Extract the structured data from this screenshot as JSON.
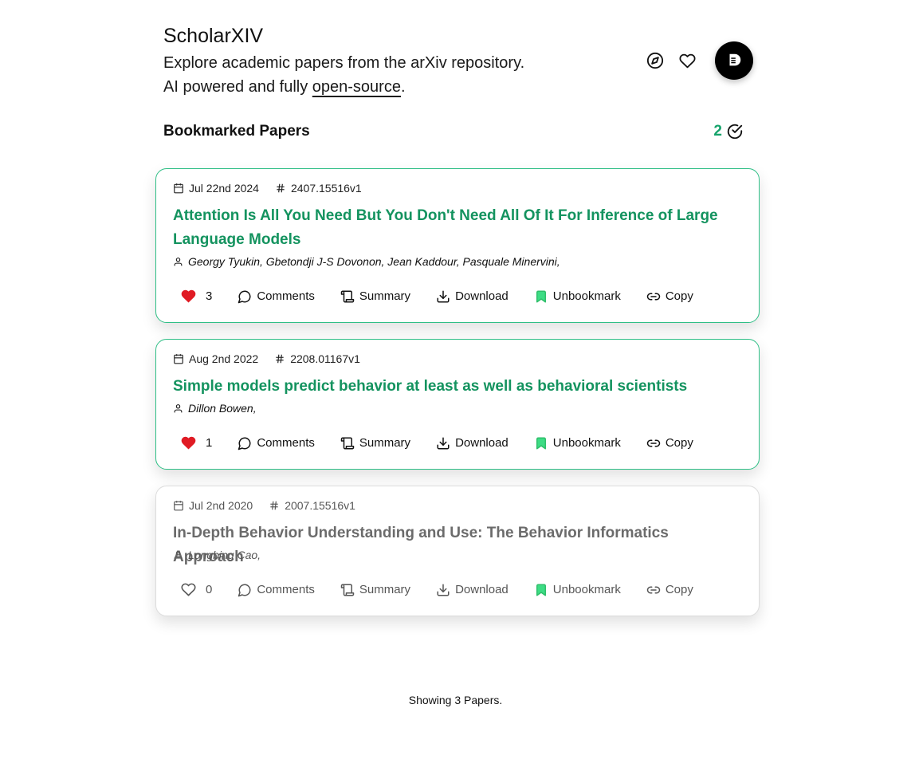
{
  "app": {
    "title": "ScholarXIV",
    "tagline_line1": "Explore academic papers from the arXiv repository.",
    "tagline_line2_prefix": "AI powered and fully ",
    "tagline_link": "open-source",
    "tagline_line2_suffix": ".",
    "avatar_initial": "D"
  },
  "section": {
    "title": "Bookmarked Papers",
    "count": "2"
  },
  "labels": {
    "comments": "Comments",
    "summary": "Summary",
    "download": "Download",
    "unbookmark": "Unbookmark",
    "copy": "Copy"
  },
  "papers": [
    {
      "date": "Jul 22nd 2024",
      "id": "2407.15516v1",
      "title": "Attention Is All You Need But You Don't Need All Of It For Inference of Large Language Models",
      "authors": "Georgy Tyukin, Gbetondji J-S Dovonon, Jean Kaddour, Pasquale Minervini,",
      "likes": "3",
      "liked": true
    },
    {
      "date": "Aug 2nd 2022",
      "id": "2208.01167v1",
      "title": "Simple models predict behavior at least as well as behavioral scientists",
      "authors": "Dillon Bowen,",
      "likes": "1",
      "liked": true
    },
    {
      "date": "Jul 2nd 2020",
      "id": "2007.15516v1",
      "title": "In-Depth Behavior Understanding and Use: The Behavior Informatics Approach",
      "authors": "Longbing Cao,",
      "likes": "0",
      "liked": false
    }
  ],
  "colors": {
    "accent": "#14935f",
    "heart": "#e01b24",
    "bookmark": "#3ddc84"
  },
  "footer": {
    "text": "Showing 3 Papers."
  }
}
